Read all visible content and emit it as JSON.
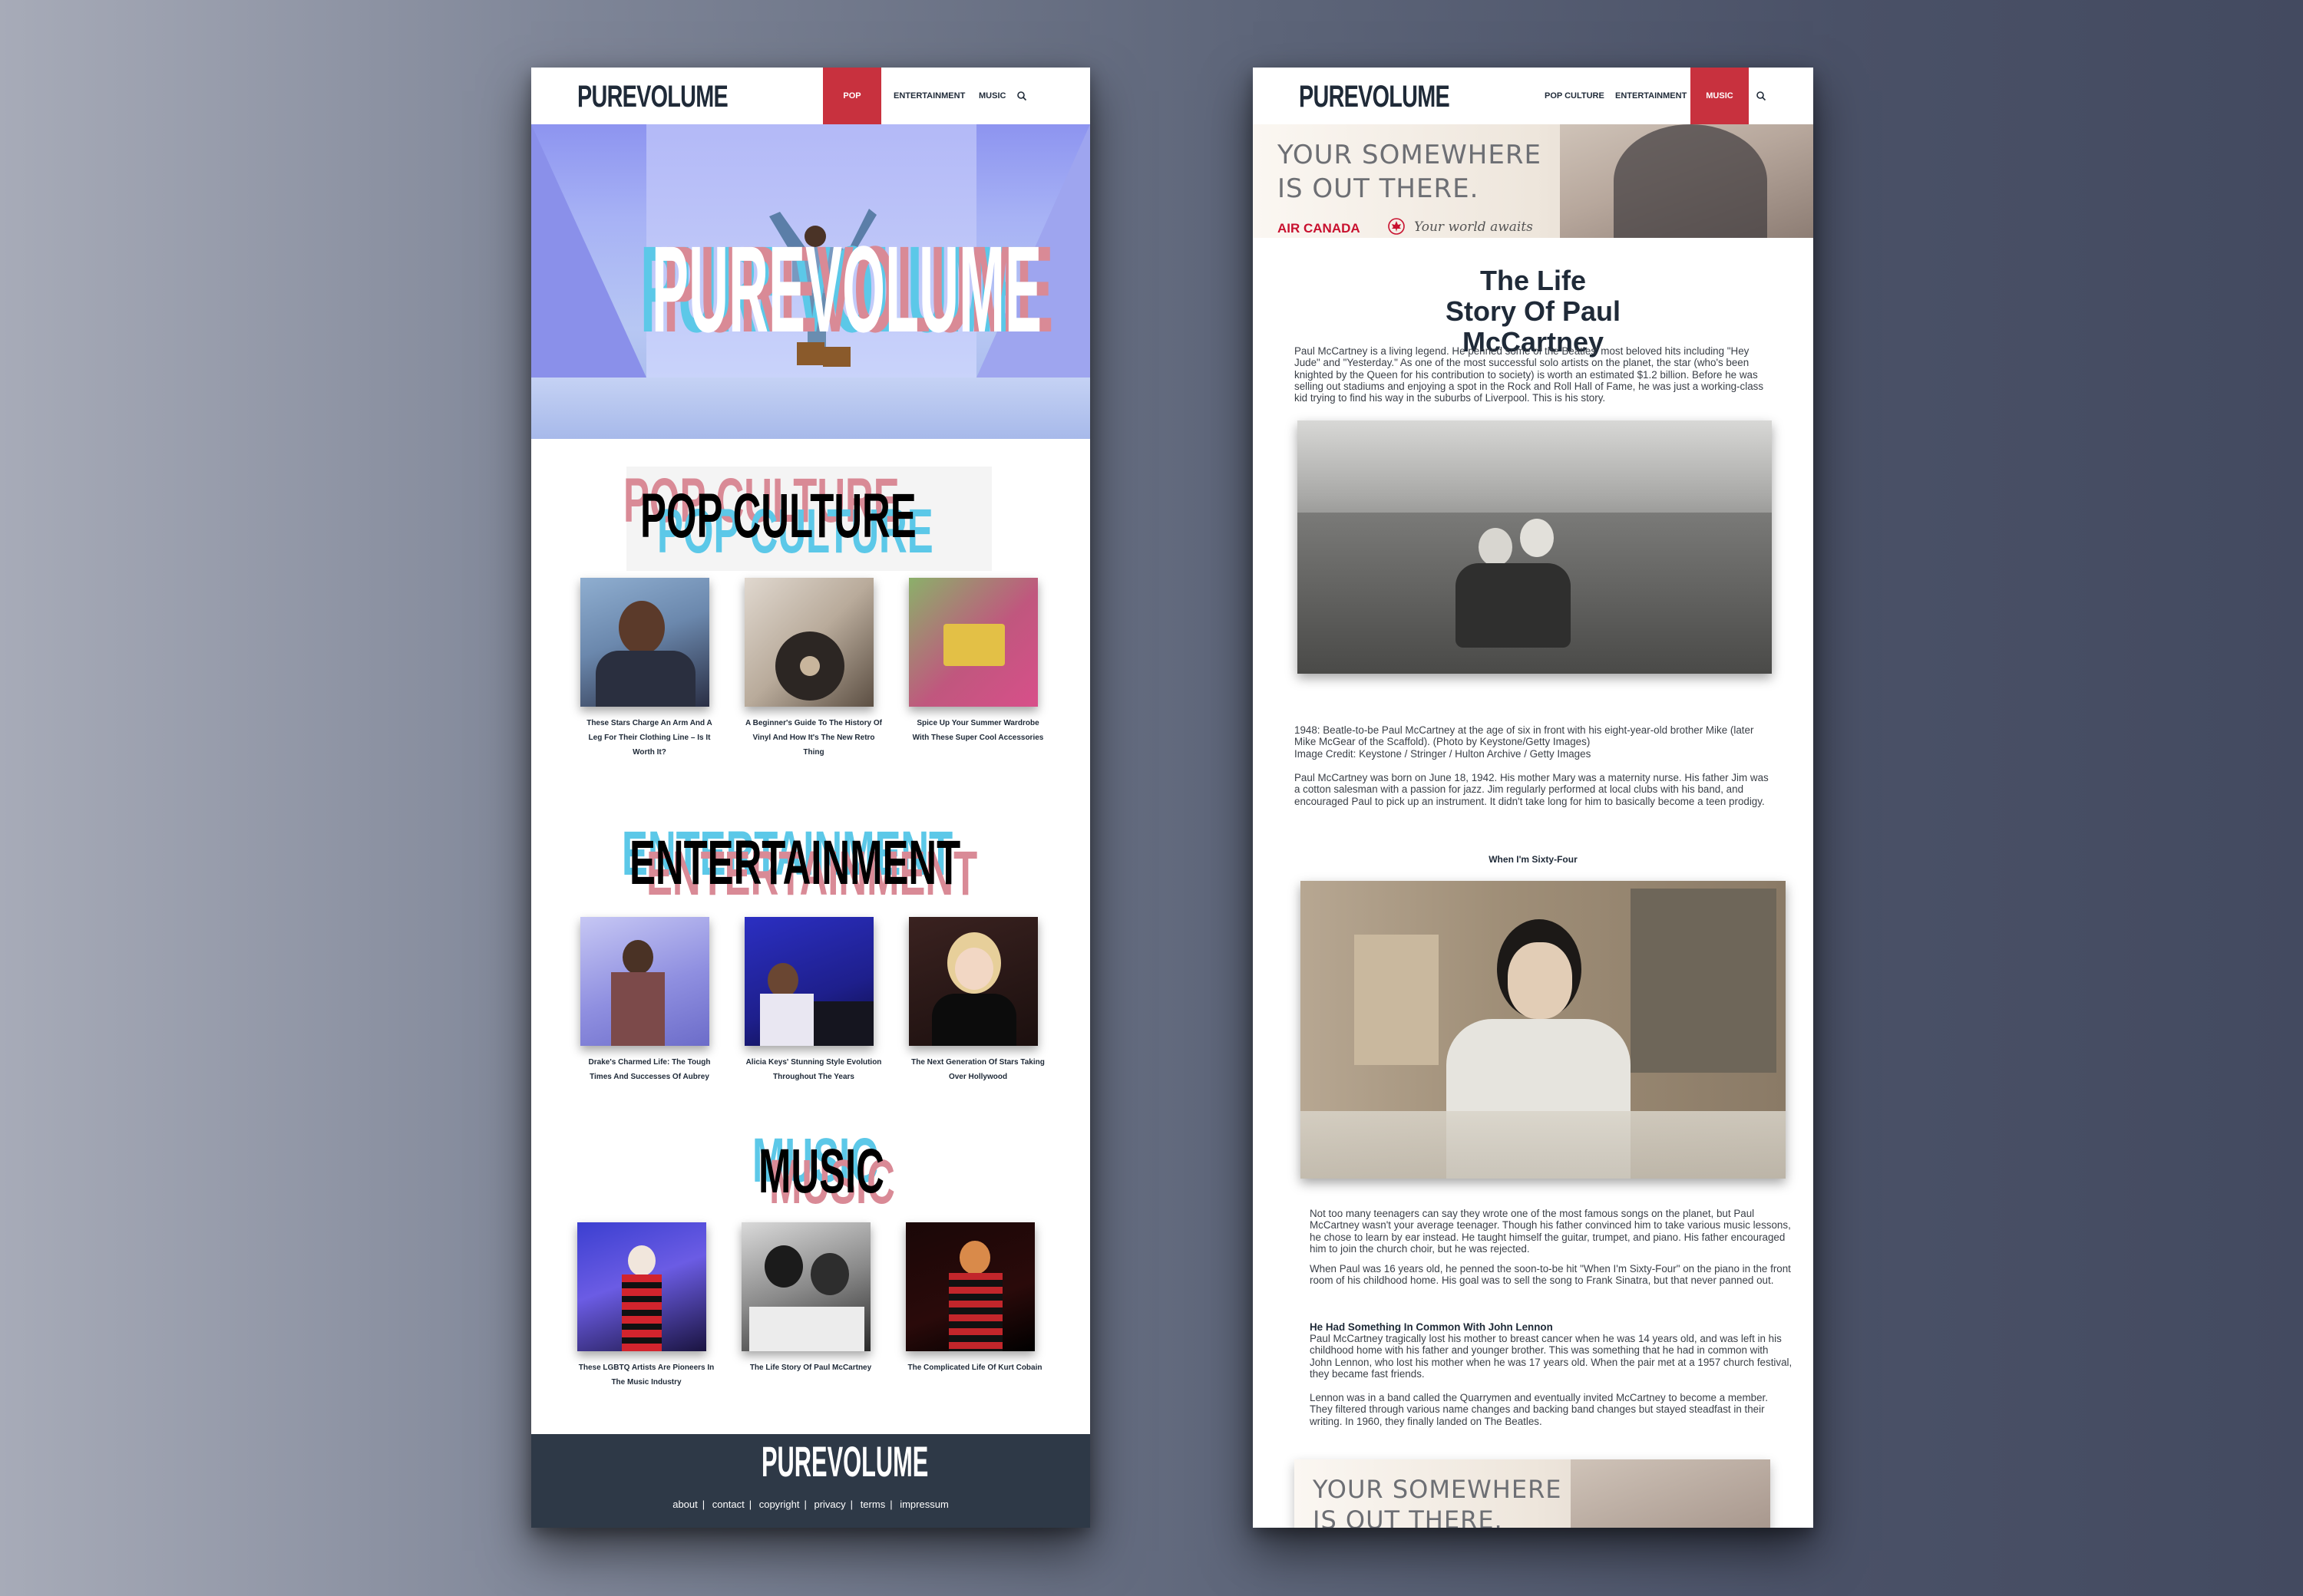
{
  "left": {
    "logo": "PUREVOLUME",
    "nav": {
      "pop_culture": "POP CULTURE",
      "entertainment": "ENTERTAINMENT",
      "music": "MUSIC"
    },
    "hero_word": "PUREVOLUME",
    "sections": [
      {
        "heading": "POP CULTURE",
        "cards": [
          {
            "title": "These Stars Charge An Arm And A Leg For Their Clothing Line – Is It Worth It?"
          },
          {
            "title": "A Beginner's Guide To The History Of Vinyl And How It's The New Retro Thing"
          },
          {
            "title": "Spice Up Your Summer Wardrobe With These Super Cool Accessories"
          }
        ]
      },
      {
        "heading": "ENTERTAINMENT",
        "cards": [
          {
            "title": "Drake's Charmed Life: The Tough Times And Successes Of Aubrey"
          },
          {
            "title": "Alicia Keys' Stunning Style Evolution Throughout The Years"
          },
          {
            "title": "The Next Generation Of Stars Taking Over Hollywood"
          }
        ]
      },
      {
        "heading": "MUSIC",
        "cards": [
          {
            "title": "These LGBTQ Artists Are Pioneers In The Music Industry"
          },
          {
            "title": "The Life Story Of Paul McCartney"
          },
          {
            "title": "The Complicated Life Of Kurt Cobain"
          }
        ]
      }
    ],
    "footer": {
      "logo": "PUREVOLUME",
      "links": [
        "about",
        "contact",
        "copyright",
        "privacy",
        "terms",
        "impressum"
      ]
    }
  },
  "right": {
    "logo": "PUREVOLUME",
    "nav": {
      "pop_culture": "POP CULTURE",
      "entertainment": "ENTERTAINMENT",
      "music": "MUSIC"
    },
    "ad": {
      "line1": "YOUR SOMEWHERE",
      "line2": "IS OUT THERE.",
      "brand": "AIR CANADA",
      "tagline": "Your world awaits"
    },
    "article": {
      "title": "The Life Story Of Paul McCartney",
      "intro": "Paul McCartney is a living legend. He penned some of the Beatles' most beloved hits including \"Hey Jude\" and \"Yesterday.\" As one of the most successful solo artists on the planet, the star (who's been knighted by the Queen for his contribution to society) is worth an estimated $1.2 billion. Before he was selling out stadiums and enjoying a spot in the Rock and Roll Hall of Fame, he was just a working-class kid trying to find his way in the suburbs of Liverpool. This is his story.",
      "caption": "1948: Beatle-to-be Paul McCartney at the age of six in front with his eight-year-old brother Mike (later Mike McGear of the Scaffold). (Photo by Keystone/Getty Images)",
      "credit": "Image Credit: Keystone / Stringer / Hulton Archive / Getty Images",
      "para2": "Paul McCartney was born on June 18, 1942. His mother Mary was a maternity nurse. His father Jim was a cotton salesman with a passion for jazz. Jim regularly performed at local clubs with his band, and encouraged Paul to pick up an instrument. It didn't take long for him to basically become a teen prodigy.",
      "subhead1": "When I'm Sixty-Four",
      "para3": "Not too many teenagers can say they wrote one of the most famous songs on the planet, but Paul McCartney wasn't your average teenager. Though his father convinced him to take various music lessons, he chose to learn by ear instead. He taught himself the guitar, trumpet, and piano. His father encouraged him to join the church choir, but he was rejected.",
      "para4": "When Paul was 16 years old, he penned the soon-to-be hit \"When I'm Sixty-Four\" on the piano in the front room of his childhood home. His goal was to sell the song to Frank Sinatra, but that never panned out.",
      "subhead2": "He Had Something In Common With John Lennon",
      "para5": "Paul McCartney tragically lost his mother to breast cancer when he was 14 years old, and was left in his childhood home with his father and younger brother. This was something that he had in common with John Lennon, who lost his mother when he was 17 years old. When the pair met at a 1957 church festival, they became fast friends.",
      "para6": "Lennon was in a band called the Quarrymen and eventually invited McCartney to become a member. They filtered through various name changes and backing band changes but stayed steadfast in their writing. In 1960, they finally landed on The Beatles.",
      "ad2_line1": "YOUR SOMEWHERE",
      "ad2_line2": "IS OUT THERE."
    }
  },
  "colors": {
    "accent_red": "#c8313e",
    "glitch_pink": "#d98a96",
    "glitch_cyan": "#5cc8e8",
    "navy": "#1f2a38"
  }
}
